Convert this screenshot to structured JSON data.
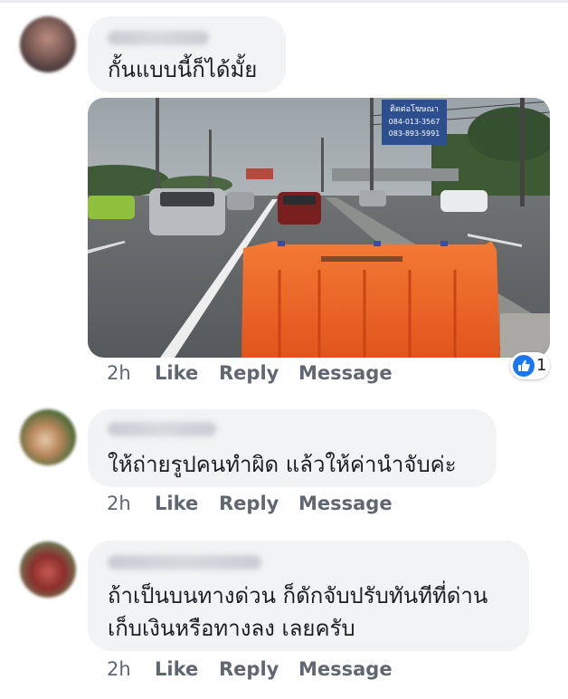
{
  "comments": [
    {
      "text_lines": [
        "กั้นแบบนี้ก็ได้มั้ย"
      ],
      "time": "2h",
      "like": "Like",
      "reply": "Reply",
      "message": "Message",
      "reactions": {
        "icon": "thumbs-up-icon",
        "count": "1",
        "color": "#1877f2"
      }
    },
    {
      "text_lines": [
        "ให้ถ่ายรูปคนทำผิด แล้วให้ค่านำจับค่ะ"
      ],
      "time": "2h",
      "like": "Like",
      "reply": "Reply",
      "message": "Message"
    },
    {
      "text_lines": [
        "ถ้าเป็นบนทางด่วน ก็ดักจับปรับทันทีที่ด่าน",
        "เก็บเงินหรือทางลง เลยครับ"
      ],
      "time": "2h",
      "like": "Like",
      "reply": "Reply",
      "message": "Message"
    }
  ],
  "photo": {
    "billboard_lines": [
      "ติดต่อโฆษณา",
      "084-013-3567",
      "083-893-5991"
    ],
    "barrier_color": "#f0611e"
  },
  "colors": {
    "bubble": "#f2f3f5",
    "action_text": "#606770",
    "like_blue": "#1877f2"
  }
}
